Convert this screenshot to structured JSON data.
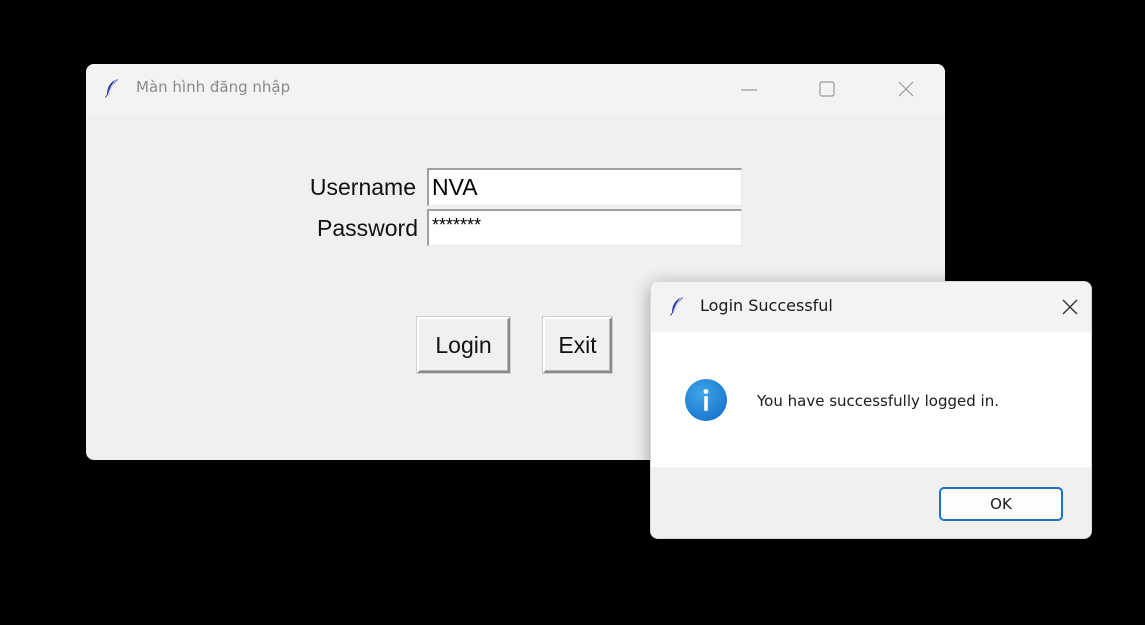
{
  "main_window": {
    "title": "Màn hình đăng nhập",
    "username_label": "Username",
    "password_label": "Password",
    "username_value": "NVA",
    "password_value": "*******",
    "login_label": "Login",
    "exit_label": "Exit",
    "icons": [
      "feather-icon",
      "minimize-icon",
      "maximize-icon",
      "close-icon"
    ]
  },
  "dialog": {
    "title": "Login Successful",
    "message": "You have successfully logged in.",
    "ok_label": "OK",
    "icons": [
      "feather-icon",
      "info-icon",
      "close-icon"
    ],
    "accent_color": "#1d73c9"
  }
}
